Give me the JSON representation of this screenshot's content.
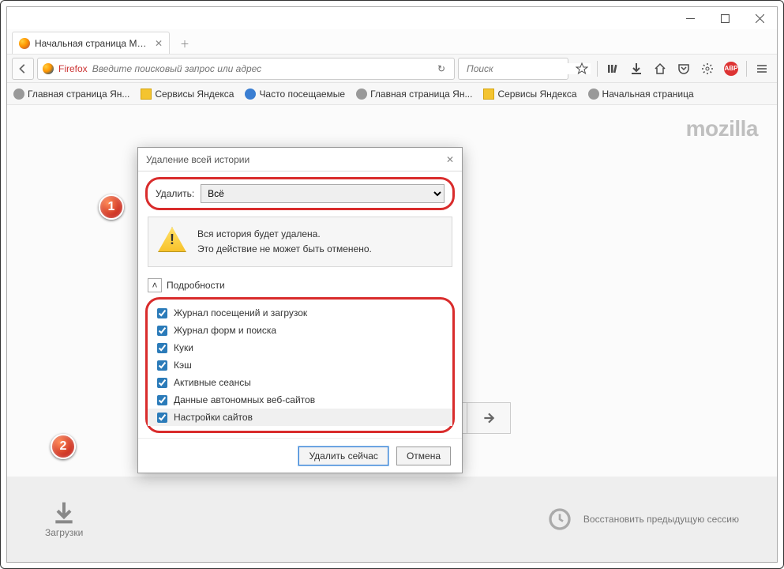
{
  "tab": {
    "title": "Начальная страница Mozill"
  },
  "nav": {
    "firefox_label": "Firefox",
    "url_placeholder": "Введите поисковый запрос или адрес",
    "search_placeholder": "Поиск"
  },
  "bookmarks": [
    {
      "label": "Главная страница Ян..."
    },
    {
      "label": "Сервисы Яндекса"
    },
    {
      "label": "Часто посещаемые"
    },
    {
      "label": "Главная страница Ян..."
    },
    {
      "label": "Сервисы Яндекса"
    },
    {
      "label": "Начальная страница"
    }
  ],
  "brand": "mozilla",
  "bottom": {
    "downloads": "Загрузки",
    "restore": "Восстановить предыдущую сессию"
  },
  "dialog": {
    "title": "Удаление всей истории",
    "delete_label": "Удалить:",
    "delete_value": "Всё",
    "warn_line1": "Вся история будет удалена.",
    "warn_line2": "Это действие не может быть отменено.",
    "details": "Подробности",
    "items": [
      "Журнал посещений и загрузок",
      "Журнал форм и поиска",
      "Куки",
      "Кэш",
      "Активные сеансы",
      "Данные автономных веб-сайтов",
      "Настройки сайтов"
    ],
    "ok": "Удалить сейчас",
    "cancel": "Отмена"
  },
  "callouts": {
    "one": "1",
    "two": "2"
  },
  "abp": "ABP"
}
